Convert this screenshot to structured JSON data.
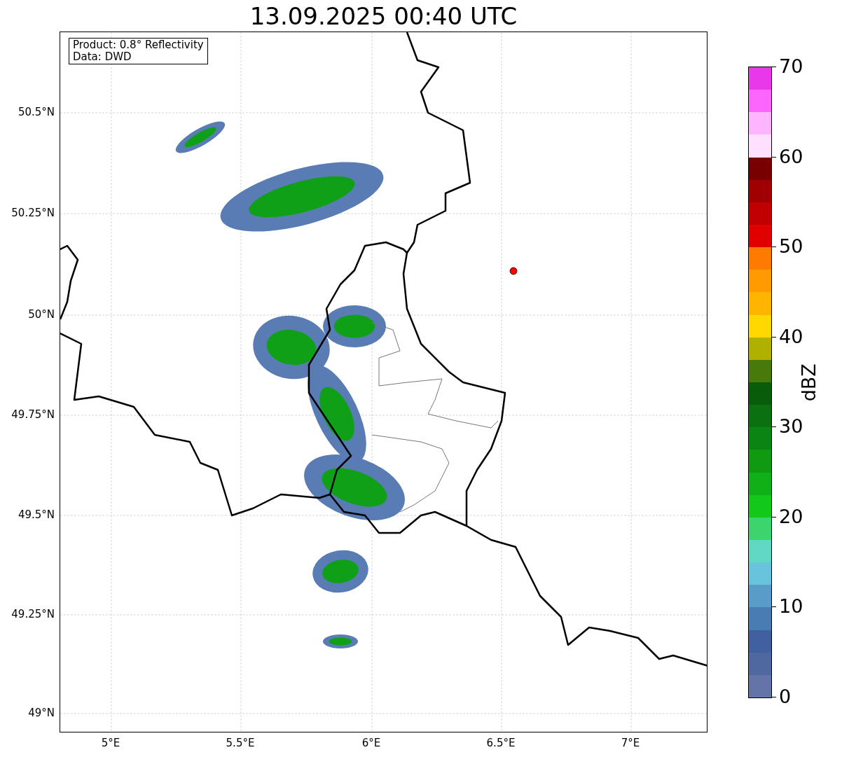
{
  "title": "13.09.2025 00:40 UTC",
  "info_box": [
    "Product: 0.8° Reflectivity",
    "Data: DWD"
  ],
  "y_ticks": [
    "50.5°N",
    "50.25°N",
    "50°N",
    "49.75°N",
    "49.5°N",
    "49.25°N",
    "49°N"
  ],
  "x_ticks": [
    "5°E",
    "5.5°E",
    "6°E",
    "6.5°E",
    "7°E"
  ],
  "colorbar": {
    "label": "dBZ",
    "ticks": [
      "70",
      "60",
      "50",
      "40",
      "30",
      "20",
      "10",
      "0"
    ],
    "segments": [
      {
        "color": "#e838e8"
      },
      {
        "color": "#fd66fd"
      },
      {
        "color": "#ffb4ff"
      },
      {
        "color": "#ffe0ff"
      },
      {
        "color": "#780000"
      },
      {
        "color": "#a00000"
      },
      {
        "color": "#c00000"
      },
      {
        "color": "#e00000"
      },
      {
        "color": "#ff7a00"
      },
      {
        "color": "#ff9a00"
      },
      {
        "color": "#ffb500"
      },
      {
        "color": "#ffd800"
      },
      {
        "color": "#b0b000"
      },
      {
        "color": "#477a0a"
      },
      {
        "color": "#085c0a"
      },
      {
        "color": "#0a7010"
      },
      {
        "color": "#0c8414"
      },
      {
        "color": "#0f9a12"
      },
      {
        "color": "#10b018"
      },
      {
        "color": "#12c81a"
      },
      {
        "color": "#3cd46c"
      },
      {
        "color": "#60d8c4"
      },
      {
        "color": "#68c4dc"
      },
      {
        "color": "#5a9cc8"
      },
      {
        "color": "#4a7cb4"
      },
      {
        "color": "#4060a0"
      },
      {
        "color": "#5068a0"
      },
      {
        "color": "#6474a8"
      }
    ]
  }
}
